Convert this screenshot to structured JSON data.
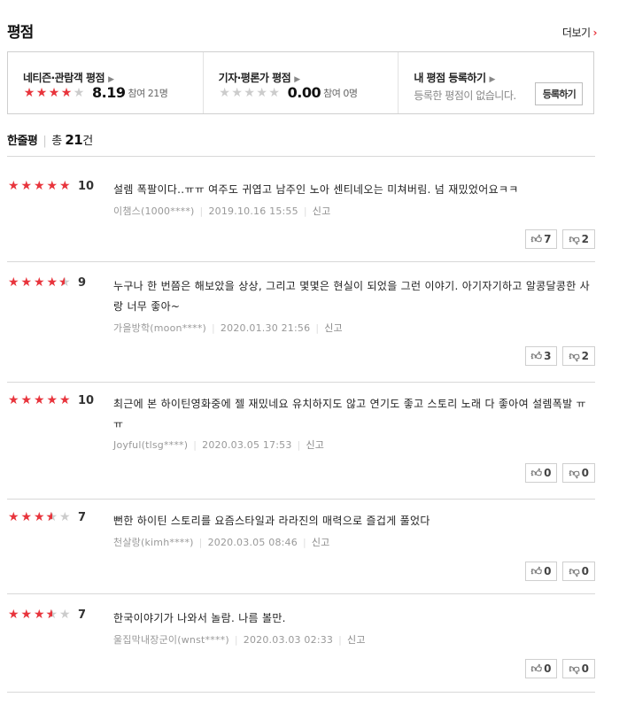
{
  "header": {
    "title": "평점",
    "more_label": "더보기"
  },
  "scorebox": {
    "netizen": {
      "label": "네티즌·관람객 평점",
      "score": "8.19",
      "participants": "참여 21명",
      "stars": 4.0
    },
    "critic": {
      "label": "기자·평론가 평점",
      "score": "0.00",
      "participants": "참여 0명",
      "stars": 0
    },
    "mine": {
      "label": "내 평점 등록하기",
      "empty_text": "등록한 평점이 없습니다.",
      "button_label": "등록하기"
    }
  },
  "oneline": {
    "label": "한줄평",
    "total_prefix": "총 ",
    "total_count": "21",
    "total_suffix": "건"
  },
  "reviews": [
    {
      "stars": 5,
      "score": "10",
      "text": "설렘 폭팔이다..ㅠㅠ 여주도 귀엽고 남주인 노아 센티네오는 미쳐버림. 넘 재밌었어요ㅋㅋ",
      "user": "이챔스(1000****)",
      "date": "2019.10.16 15:55",
      "report": "신고",
      "likes": "7",
      "dislikes": "2"
    },
    {
      "stars": 4.5,
      "score": "9",
      "text": "누구나 한 번쯤은 해보았을 상상, 그리고 몇몇은 현실이 되었을 그런 이야기. 아기자기하고 알콩달콩한 사랑 너무 좋아~",
      "user": "가을방학(moon****)",
      "date": "2020.01.30 21:56",
      "report": "신고",
      "likes": "3",
      "dislikes": "2"
    },
    {
      "stars": 5,
      "score": "10",
      "text": "최근에 본 하이틴영화중에 젤 재밌네요 유치하지도 않고 연기도 좋고 스토리 노래 다 좋아여 설렘폭발 ㅠㅠ",
      "user": "Joyful(tlsg****)",
      "date": "2020.03.05 17:53",
      "report": "신고",
      "likes": "0",
      "dislikes": "0"
    },
    {
      "stars": 3.5,
      "score": "7",
      "text": "뻔한 하이틴 스토리를 요즘스타일과 라라진의 매력으로 즐겁게 풀었다",
      "user": "천살랑(kimh****)",
      "date": "2020.03.05 08:46",
      "report": "신고",
      "likes": "0",
      "dislikes": "0"
    },
    {
      "stars": 3.5,
      "score": "7",
      "text": "한국이야기가 나와서 놀람. 나름 볼만.",
      "user": "울집막내장군이(wnst****)",
      "date": "2020.03.03 02:33",
      "report": "신고",
      "likes": "0",
      "dislikes": "0"
    }
  ],
  "icons": {
    "like": "thumbs-up-icon",
    "dislike": "thumbs-down-icon",
    "star": "star-icon",
    "chevron": "chevron-right-icon"
  },
  "colors": {
    "accent": "#e8343c",
    "star_off": "#cccccc"
  }
}
